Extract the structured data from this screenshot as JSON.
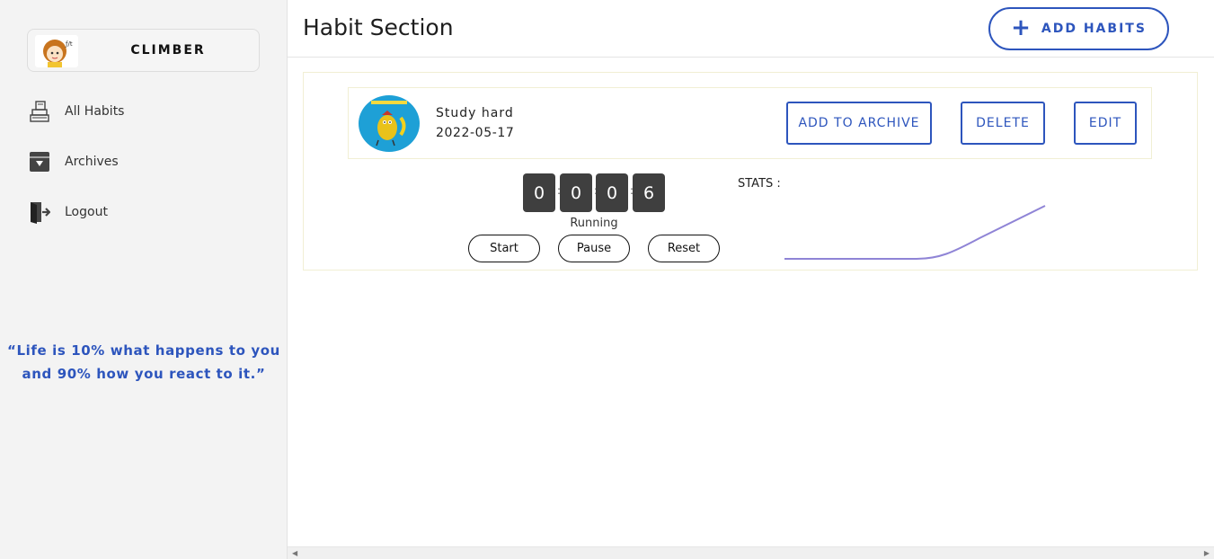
{
  "sidebar": {
    "profile_name": "CLIMBER",
    "nav": [
      {
        "label": "All Habits",
        "icon": "books-stack-icon"
      },
      {
        "label": "Archives",
        "icon": "archive-box-icon"
      },
      {
        "label": "Logout",
        "icon": "logout-door-icon"
      }
    ],
    "quote_line1": "“Life is 10% what happens to you",
    "quote_line2": "and 90% how you react to it.”"
  },
  "header": {
    "title": "Habit Section",
    "add_button_icon": "+",
    "add_button_label": "ADD HABITS"
  },
  "habit": {
    "name": "Study hard",
    "date": "2022-05-17",
    "archive_label": "ADD TO ARCHIVE",
    "delete_label": "DELETE",
    "edit_label": "EDIT"
  },
  "timer": {
    "digits": [
      "0",
      "0",
      "0",
      "6"
    ],
    "separator": ":",
    "status": "Running",
    "start_label": "Start",
    "pause_label": "Pause",
    "reset_label": "Reset"
  },
  "stats": {
    "label": "STATS :",
    "line_color": "#8f84d6"
  },
  "colors": {
    "accent": "#2d55bd",
    "sidebar_bg": "#f3f3f3",
    "digit_bg": "#3f3f3f"
  }
}
